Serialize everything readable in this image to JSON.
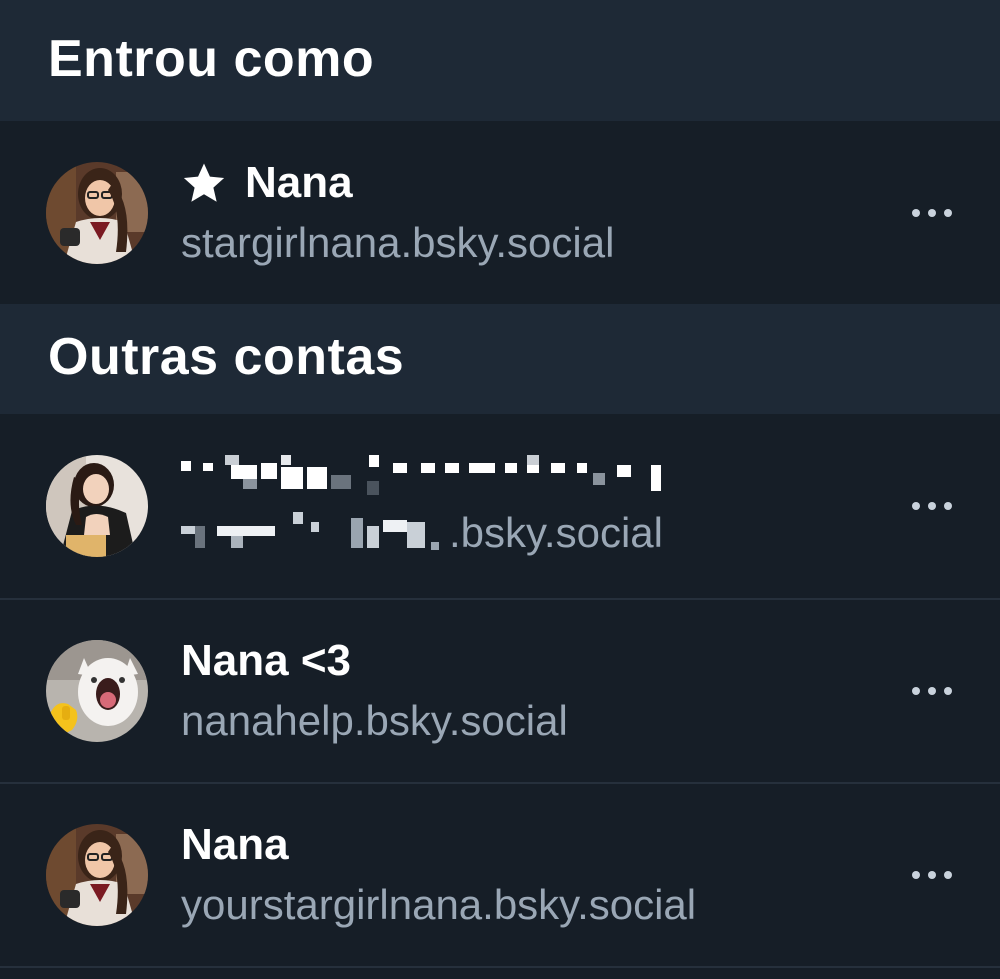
{
  "signed_in_section": {
    "title": "Entrou como"
  },
  "current_account": {
    "display_name": "Nana",
    "handle": "stargirlnana.bsky.social",
    "is_favorite_icon": "star-icon"
  },
  "other_accounts_section": {
    "title": "Outras contas"
  },
  "other_accounts": [
    {
      "display_name_obscured": true,
      "handle_suffix": ".bsky.social"
    },
    {
      "display_name": "Nana <3",
      "handle": "nanahelp.bsky.social"
    },
    {
      "display_name": "Nana",
      "handle": "yourstargirlnana.bsky.social"
    }
  ],
  "icons": {
    "more": "more-horizontal-icon",
    "favorite": "star-icon"
  },
  "colors": {
    "background": "#161e27",
    "section_header": "#1e2936",
    "primary_text": "#ffffff",
    "secondary_text": "#9aa7b5",
    "divider": "#26303c"
  }
}
